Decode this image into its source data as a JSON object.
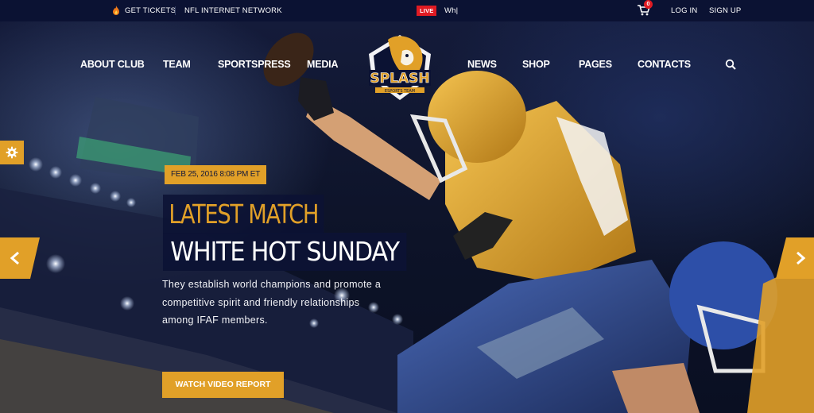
{
  "topbar": {
    "tickets_label": "GET TICKETS",
    "network_label": "NFL INTERNET NETWORK",
    "live_label": "LIVE",
    "ticker_text": "Wh|",
    "cart_count": "0",
    "login_label": "LOG IN",
    "signup_label": "SIGN UP"
  },
  "nav": {
    "items": [
      "ABOUT CLUB",
      "TEAM",
      "SPORTSPRESS",
      "MEDIA",
      "NEWS",
      "SHOP",
      "PAGES",
      "CONTACTS"
    ]
  },
  "logo": {
    "name": "SPLASH",
    "tagline": "ESPORTS TEAM"
  },
  "hero": {
    "date": "FEB 25, 2016 8:08 PM ET",
    "title_line1": "LATEST MATCH",
    "title_line2": "WHITE HOT SUNDAY",
    "description": "They establish world champions and promote a competitive spirit and friendly relationships among IFAF members.",
    "button_label": "WATCH VIDEO REPORT"
  },
  "icons": {
    "tickets": "fire-icon",
    "cart": "cart-icon",
    "search": "search-icon",
    "settings": "gear-icon",
    "prev": "chevron-left-icon",
    "next": "chevron-right-icon"
  },
  "colors": {
    "accent": "#e1a028",
    "navy": "#0b1233",
    "live_red": "#e01b23"
  }
}
